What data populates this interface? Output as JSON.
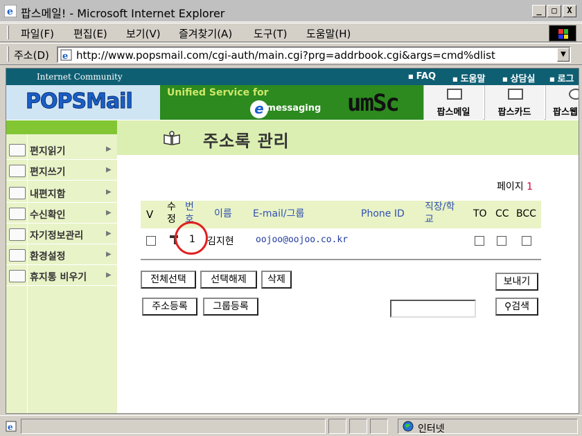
{
  "window": {
    "title": "팝스메일! - Microsoft Internet Explorer",
    "buttons": [
      "_",
      "□",
      "X"
    ]
  },
  "menu": [
    "파일(F)",
    "편집(E)",
    "보기(V)",
    "즐겨찾기(A)",
    "도구(T)",
    "도움말(H)"
  ],
  "address": {
    "label": "주소(D)",
    "url": "http://www.popsmail.com/cgi-auth/main.cgi?prg=addrbook.cgi&args=cmd%dlist"
  },
  "site": {
    "community": "Internet Community",
    "toplinks": [
      "FAQ",
      "도움말",
      "상담실",
      "로그"
    ],
    "logo": "POPSMail",
    "banner_line1": "Unified Service for",
    "banner_e": "e",
    "banner_line2": "-messaging",
    "banner_brand": "umSc",
    "nav": [
      "팝스메일",
      "팝스카드",
      "팝스웹"
    ]
  },
  "sidebar": {
    "items": [
      "편지읽기",
      "편지쓰기",
      "내편지함",
      "수신확인",
      "자기정보관리",
      "환경설정",
      "휴지통 비우기"
    ],
    "arrow": "▶"
  },
  "main": {
    "title": "주소록 관리",
    "page_label": "페이지",
    "page_number": "1",
    "headers": {
      "check": "V",
      "edit_1": "수",
      "edit_2": "정",
      "num_1": "번",
      "num_2": "호",
      "name": "이름",
      "email": "E-mail/그룹",
      "phone": "Phone ID",
      "org_1": "직장/학",
      "org_2": "교",
      "to": "TO",
      "cc": "CC",
      "bcc": "BCC"
    },
    "rows": [
      {
        "number": "1",
        "name": "김지현",
        "email": "oojoo@oojoo.co.kr",
        "phone": ""
      }
    ],
    "buttons": {
      "select_all": "전체선택",
      "deselect": "선택해제",
      "delete": "삭제",
      "send": "보내기",
      "add_address": "주소등록",
      "add_group": "그룹등록",
      "search": "검색"
    }
  },
  "status": {
    "zone": "인터넷"
  },
  "colors": {
    "topstrip": "#0f5f73",
    "sidebar": "#e8f3c8",
    "accent_green": "#82c634",
    "annotation_circle": "#e02020"
  }
}
